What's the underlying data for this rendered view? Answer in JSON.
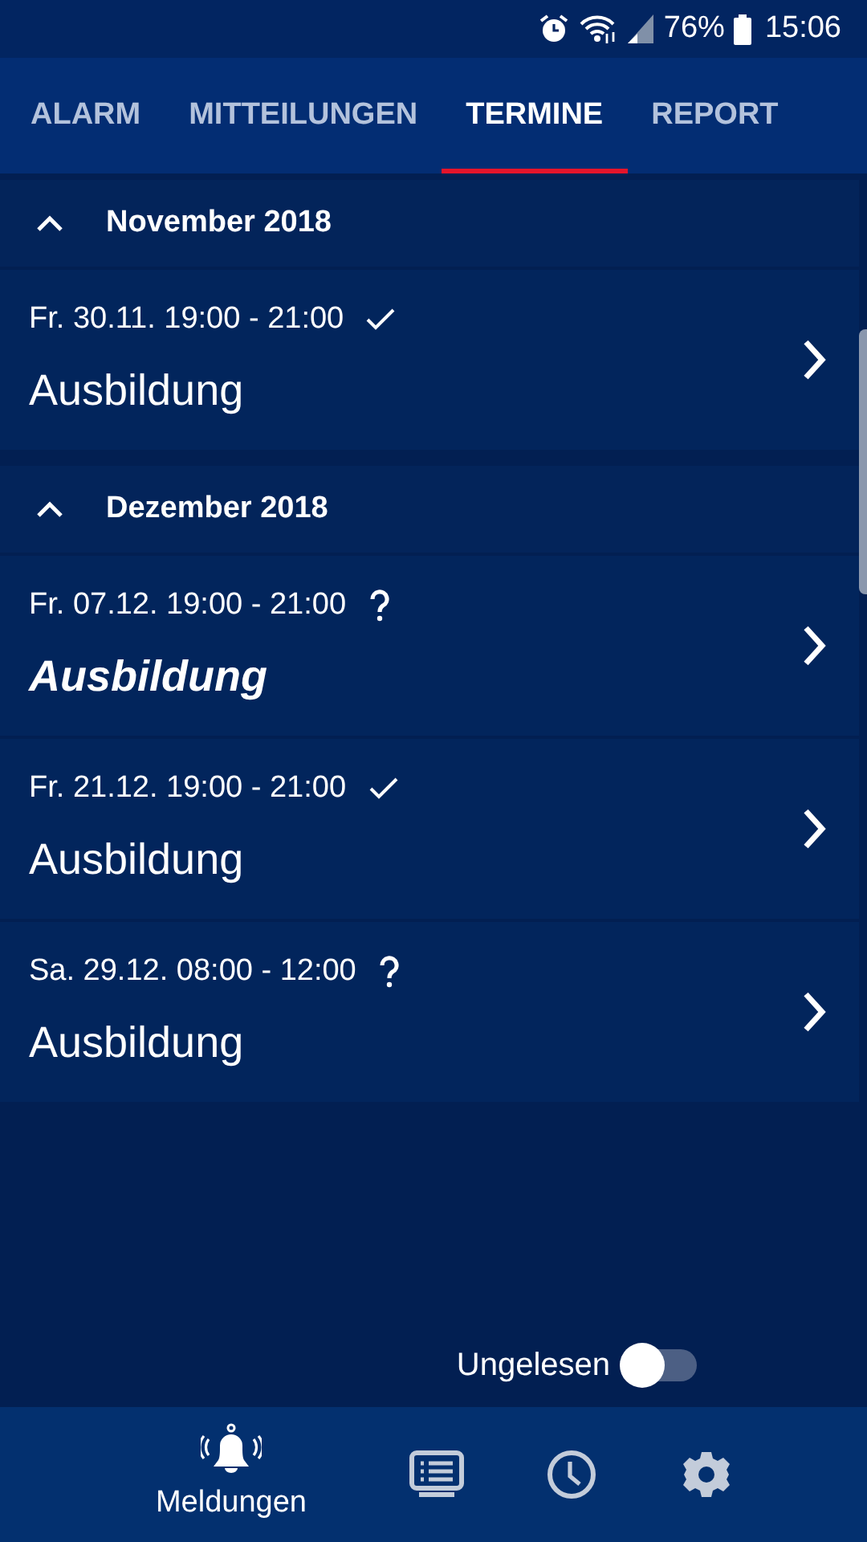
{
  "status_bar": {
    "battery": "76%",
    "time": "15:06"
  },
  "tabs": [
    {
      "label": "ALARM",
      "selected": false
    },
    {
      "label": "MITTEILUNGEN",
      "selected": false
    },
    {
      "label": "TERMINE",
      "selected": true
    },
    {
      "label": "REPORT",
      "selected": false
    }
  ],
  "sections": [
    {
      "title": "November 2018",
      "expanded": true,
      "events": [
        {
          "when": "Fr. 30.11. 19:00 - 21:00",
          "confirmed": true,
          "title": "Ausbildung",
          "unread": false
        }
      ]
    },
    {
      "title": "Dezember 2018",
      "expanded": true,
      "events": [
        {
          "when": "Fr. 07.12. 19:00 - 21:00",
          "confirmed": false,
          "title": "Ausbildung",
          "unread": true
        },
        {
          "when": "Fr. 21.12. 19:00 - 21:00",
          "confirmed": true,
          "title": "Ausbildung",
          "unread": false
        },
        {
          "when": "Sa. 29.12. 08:00 - 12:00",
          "confirmed": false,
          "title": "Ausbildung",
          "unread": false
        }
      ]
    }
  ],
  "unread_filter": {
    "label": "Ungelesen",
    "on": false
  },
  "bottom_nav": [
    {
      "kind": "bell",
      "label": "Meldungen",
      "selected": true
    },
    {
      "kind": "list",
      "selected": false
    },
    {
      "kind": "clock",
      "selected": false
    },
    {
      "kind": "gear",
      "selected": false
    }
  ]
}
